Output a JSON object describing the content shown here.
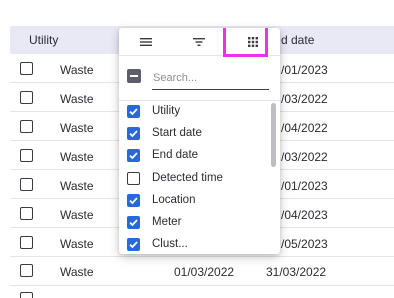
{
  "grid": {
    "columns": {
      "utility": "Utility",
      "end_date_partial": "d date"
    },
    "rows": [
      {
        "utility": "Waste",
        "start": "",
        "end_partial": "/01/2023"
      },
      {
        "utility": "Waste",
        "start": "",
        "end_partial": "/03/2022"
      },
      {
        "utility": "Waste",
        "start": "",
        "end_partial": "/04/2022"
      },
      {
        "utility": "Waste",
        "start": "",
        "end_partial": "/03/2022"
      },
      {
        "utility": "Waste",
        "start": "",
        "end_partial": "/01/2023"
      },
      {
        "utility": "Waste",
        "start": "",
        "end_partial": "/04/2023"
      },
      {
        "utility": "Waste",
        "start": "",
        "end_partial": "/05/2023"
      },
      {
        "utility": "Waste",
        "start": "01/03/2022",
        "end_partial": "31/03/2022"
      }
    ]
  },
  "panel": {
    "tabs": [
      {
        "name": "columns-tab",
        "icon": "menu-icon"
      },
      {
        "name": "filter-tab",
        "icon": "filter-icon"
      },
      {
        "name": "density-tab",
        "icon": "grid-icon",
        "active": true
      }
    ],
    "highlight_color": "#e834e5",
    "search": {
      "placeholder": "Search...",
      "value": ""
    },
    "columns": [
      {
        "label": "Utility",
        "checked": true
      },
      {
        "label": "Start date",
        "checked": true
      },
      {
        "label": "End date",
        "checked": true
      },
      {
        "label": "Detected time",
        "checked": false
      },
      {
        "label": "Location",
        "checked": true
      },
      {
        "label": "Meter",
        "checked": true
      },
      {
        "label": "Clust...",
        "checked": true
      }
    ]
  },
  "colors": {
    "checkbox_blue": "#2868d8",
    "header_bg": "#e9e9f6"
  }
}
